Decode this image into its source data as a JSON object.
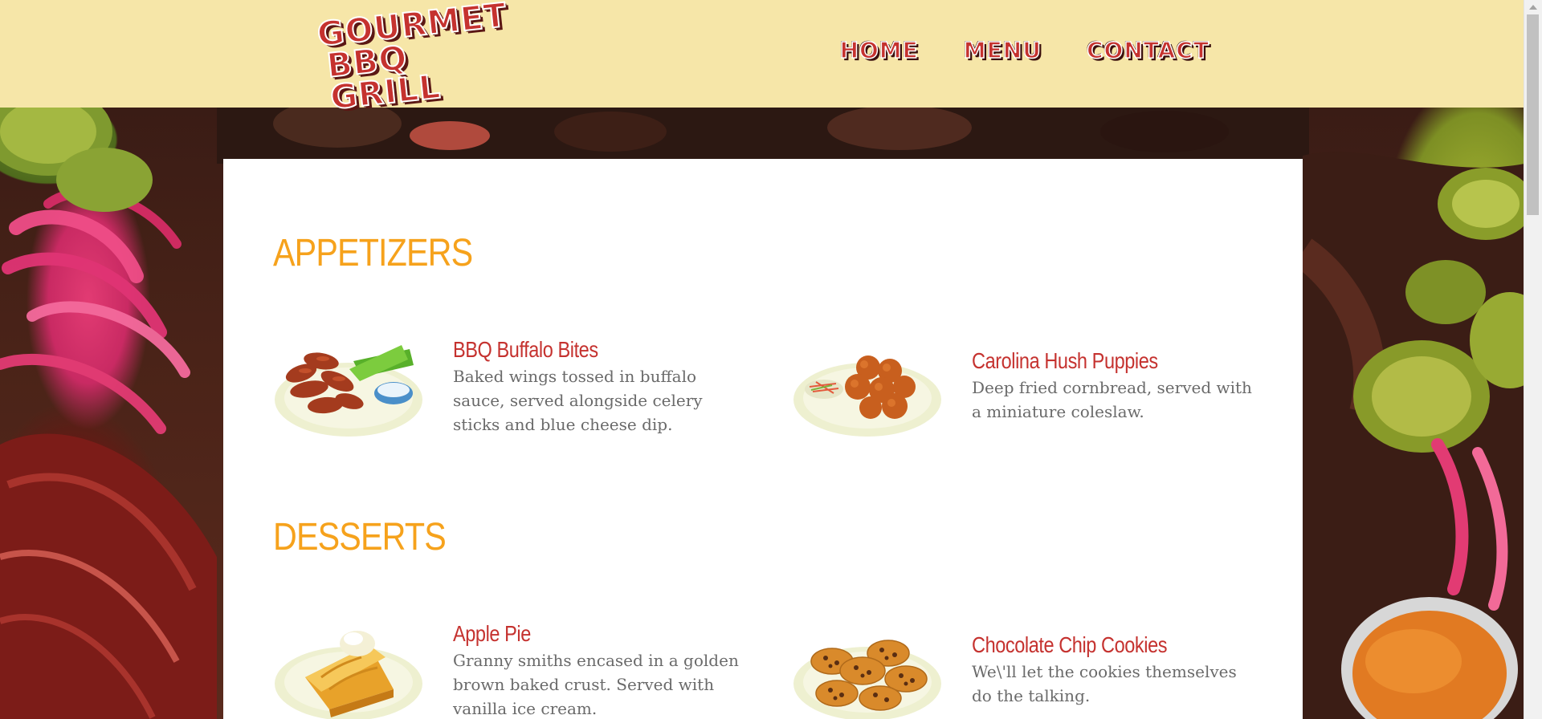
{
  "header": {
    "logo_line1": "GOURMET",
    "logo_line2": "BBQ GRILL",
    "nav": [
      "HOME",
      "MENU",
      "CONTACT"
    ]
  },
  "menu": {
    "sections": [
      {
        "title": "APPETIZERS",
        "items": [
          {
            "name": "BBQ Buffalo Bites",
            "description": "Baked wings tossed in buffalo sauce, served alongside celery sticks and blue cheese dip.",
            "icon": "buffalo-wings-icon"
          },
          {
            "name": "Carolina Hush Puppies",
            "description": "Deep fried cornbread, served with a miniature coleslaw.",
            "icon": "hush-puppies-icon"
          }
        ]
      },
      {
        "title": "DESSERTS",
        "items": [
          {
            "name": "Apple Pie",
            "description": "Granny smiths encased in a golden brown baked crust. Served with vanilla ice cream.",
            "icon": "apple-pie-icon"
          },
          {
            "name": "Chocolate Chip Cookies",
            "description": "We\\'ll let the cookies themselves do the talking.",
            "icon": "cookies-icon"
          }
        ]
      }
    ]
  },
  "colors": {
    "header_bg": "#f6e6a8",
    "section_title": "#f6a21c",
    "item_name": "#c5322f",
    "item_desc": "#6a6a6a",
    "logo_red": "#c5322f"
  }
}
